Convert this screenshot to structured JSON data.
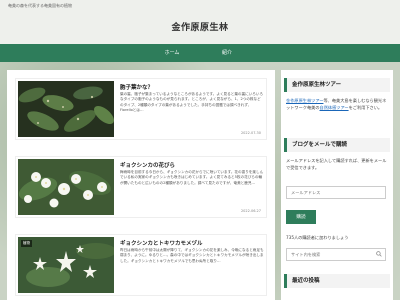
{
  "header": {
    "tagline": "奄美の森を代表する奄美固有の植物",
    "site_title": "金作原原生林"
  },
  "nav": {
    "items": [
      {
        "label": "ホーム"
      },
      {
        "label": "紹介"
      }
    ],
    "colors": {
      "nav_bg": "#2e7d5b"
    }
  },
  "posts": [
    {
      "title": "胞子葉かな？",
      "snippet": "葉の裏、胞子が集まっているようなところがあるようです。よく見ると葉の裏にいろいろなタイプの胞子のようなものが見られます。ところが、よく見ながら、1、2つの株などのタイプ、2種類のタイプの葉があるようでした。手持ちの図鑑では調べきれず、Fiorelloとは…",
      "date": "2022.07.30",
      "thumb_kind": "dark-leaves"
    },
    {
      "title": "ギョクシンカの花びら",
      "snippet": "梅雨時を目前する今日から、ギョクシンカの花からでに咲いています。花の香りを楽しんでいる私の実家のギョクシンカも咲きはじめています。よく見てみると5枚の花びらの輪が開いたものと広いものの2種類がありました。調べて見たのですが、奄美と鹿児…",
      "date": "2022.06.27",
      "thumb_kind": "white-flowers"
    },
    {
      "title": "ギョクシンカとトキワカモメヅル",
      "snippet": "昨日は雨時から午前中は太陽が降りて、ギョクシンカの花を楽しみ、今晩になると雨足も弱まり、ように。ゆるりと…。森の中ではギョクシンカとトキワカモメヅルが咲き出しました。ギョクシンカとトキワカモメヅルでも思わぬ所と取り…",
      "date": "",
      "category": "植物",
      "thumb_kind": "star-flowers"
    }
  ],
  "sidebar": {
    "tour": {
      "heading": "金作原原生林ツアー",
      "link1": "金作原原生林ツアー",
      "text1": "等、奄美大島を楽しむなら観光ネットワーク奄美の",
      "link2": "自然体感ツアー",
      "text2": "をご利用下さい。"
    },
    "subscribe": {
      "heading": "ブログをメールで購読",
      "description": "メールアドレスを記入して購読すれば、更新をメールで受信できます。",
      "email_placeholder": "メールアドレス",
      "button_label": "購読",
      "subscribers": "735人の購読者に加わりましょう"
    },
    "search": {
      "placeholder": "サイト内を検索"
    },
    "recent": {
      "heading": "最近の投稿"
    }
  }
}
